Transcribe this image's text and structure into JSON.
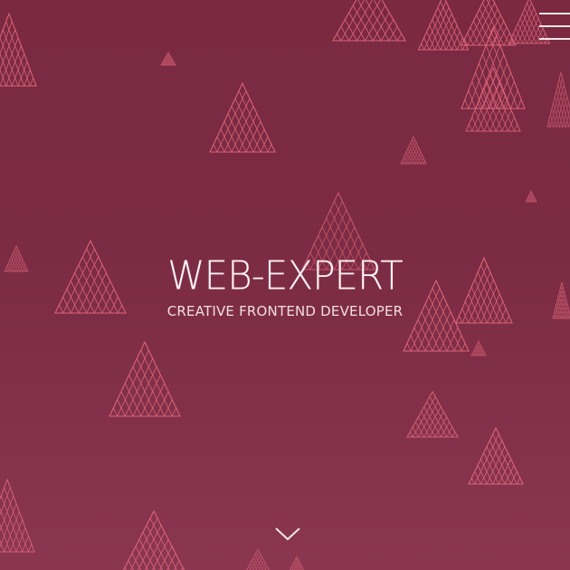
{
  "colors": {
    "background": "#7a2941",
    "accent": "#e66a7f",
    "text": "#ffffff"
  },
  "menu": {
    "icon": "hamburger-menu-icon"
  },
  "hero": {
    "title": "WEB-EXPERT",
    "subtitle": "CREATIVE FRONTEND DEVELOPER"
  },
  "scroll": {
    "icon": "chevron-down-icon"
  }
}
